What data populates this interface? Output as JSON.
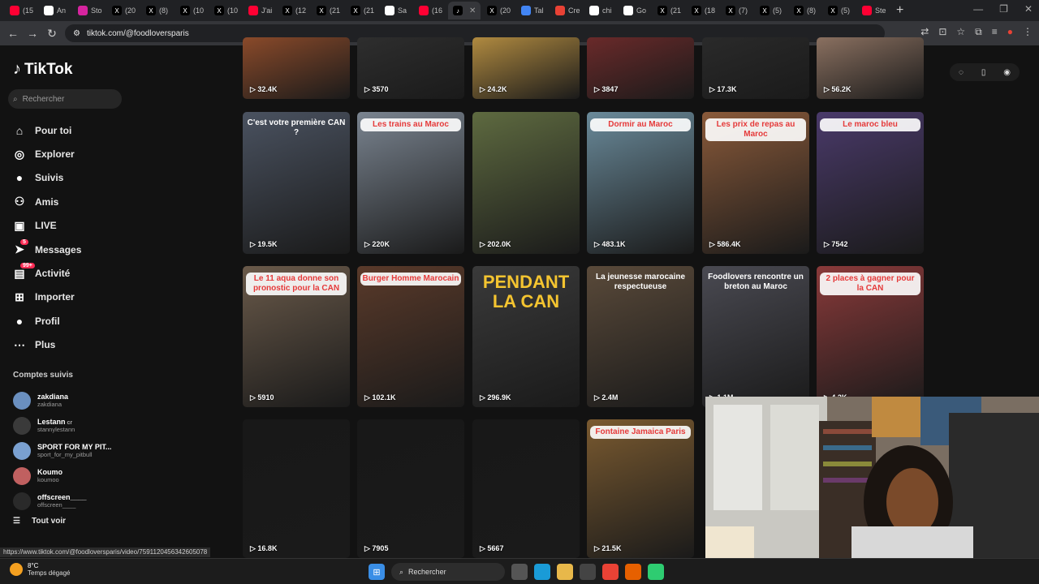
{
  "browser": {
    "tabs": [
      {
        "label": "(15",
        "icon": "youtube-icon",
        "color": "#ff0033"
      },
      {
        "label": "An",
        "icon": "wikipedia-icon",
        "color": "#ffffff"
      },
      {
        "label": "Sto",
        "icon": "instagram-icon",
        "color": "#d6249f"
      },
      {
        "label": "(20",
        "icon": "x-icon",
        "color": "#000000"
      },
      {
        "label": "(8)",
        "icon": "x-icon",
        "color": "#000000"
      },
      {
        "label": "(10",
        "icon": "x-icon",
        "color": "#000000"
      },
      {
        "label": "(10",
        "icon": "x-icon",
        "color": "#000000"
      },
      {
        "label": "J'ai",
        "icon": "youtube-icon",
        "color": "#ff0033"
      },
      {
        "label": "(12",
        "icon": "x-icon",
        "color": "#000000"
      },
      {
        "label": "(21",
        "icon": "x-icon",
        "color": "#000000"
      },
      {
        "label": "(21",
        "icon": "x-icon",
        "color": "#000000"
      },
      {
        "label": "Sa",
        "icon": "page-icon",
        "color": "#ffffff"
      },
      {
        "label": "(16",
        "icon": "youtube-icon",
        "color": "#ff0033"
      },
      {
        "label": "",
        "icon": "tiktok-icon",
        "color": "#000000",
        "active": true
      },
      {
        "label": "(20",
        "icon": "x-icon",
        "color": "#000000"
      },
      {
        "label": "Tal",
        "icon": "translate-icon",
        "color": "#4285f4"
      },
      {
        "label": "Cre",
        "icon": "page-icon",
        "color": "#e94235"
      },
      {
        "label": "chi",
        "icon": "google-icon",
        "color": "#ffffff"
      },
      {
        "label": "Go",
        "icon": "google-icon",
        "color": "#ffffff"
      },
      {
        "label": "(21",
        "icon": "x-icon",
        "color": "#000000"
      },
      {
        "label": "(18",
        "icon": "x-icon",
        "color": "#000000"
      },
      {
        "label": "(7)",
        "icon": "x-icon",
        "color": "#000000"
      },
      {
        "label": "(5)",
        "icon": "x-icon",
        "color": "#000000"
      },
      {
        "label": "(8)",
        "icon": "x-icon",
        "color": "#000000"
      },
      {
        "label": "(5)",
        "icon": "x-icon",
        "color": "#000000"
      },
      {
        "label": "Ste",
        "icon": "youtube-icon",
        "color": "#ff0033"
      }
    ],
    "url": "tiktok.com/@foodloversparis",
    "status_url": "https://www.tiktok.com/@foodloversparis/video/7591120456342605078"
  },
  "sidebar": {
    "logo": "TikTok",
    "search_placeholder": "Rechercher",
    "nav": [
      {
        "label": "Pour toi",
        "icon": "home-icon",
        "glyph": "⌂"
      },
      {
        "label": "Explorer",
        "icon": "compass-icon",
        "glyph": "◎"
      },
      {
        "label": "Suivis",
        "icon": "avatar-icon",
        "glyph": "●"
      },
      {
        "label": "Amis",
        "icon": "friends-icon",
        "glyph": "⚇"
      },
      {
        "label": "LIVE",
        "icon": "live-icon",
        "glyph": "▣"
      },
      {
        "label": "Messages",
        "icon": "messages-icon",
        "glyph": "➤",
        "badge": "5"
      },
      {
        "label": "Activité",
        "icon": "activity-icon",
        "glyph": "▤",
        "badge": "99+"
      },
      {
        "label": "Importer",
        "icon": "upload-icon",
        "glyph": "⊞"
      },
      {
        "label": "Profil",
        "icon": "profile-icon",
        "glyph": "●"
      },
      {
        "label": "Plus",
        "icon": "more-icon",
        "glyph": "⋯"
      }
    ],
    "following_title": "Comptes suivis",
    "following": [
      {
        "name": "zakdiana",
        "handle": "zakdiana",
        "color": "#6a8fbf"
      },
      {
        "name": "Lestann",
        "handle": "stannylestann",
        "color": "#3a3a3a",
        "suffix": "cr"
      },
      {
        "name": "SPORT FOR MY PIT...",
        "handle": "sport_for_my_pitbull",
        "color": "#7aa0d0"
      },
      {
        "name": "Koumo",
        "handle": "koumoo",
        "color": "#c06060"
      },
      {
        "name": "offscreen____",
        "handle": "offscreen____",
        "color": "#2a2a2a"
      }
    ],
    "see_all": "Tout voir"
  },
  "toolbar_right": [
    "gauge-icon",
    "phone-icon",
    "avatar-icon"
  ],
  "videos": [
    {
      "row": 0,
      "col": 0,
      "count": "32.4K",
      "bg": "#8a4a2a",
      "caption": "",
      "capcolor": "#fff"
    },
    {
      "row": 0,
      "col": 1,
      "count": "3570",
      "bg": "#2e2e2e",
      "caption": "",
      "capcolor": "#fff"
    },
    {
      "row": 0,
      "col": 2,
      "count": "24.2K",
      "bg": "#b08a40",
      "caption": "",
      "capcolor": "#fff"
    },
    {
      "row": 0,
      "col": 3,
      "count": "3847",
      "bg": "#6a2a2a",
      "caption": "",
      "capcolor": "#fff"
    },
    {
      "row": 0,
      "col": 4,
      "count": "17.3K",
      "bg": "#2a2a2a",
      "caption": "",
      "capcolor": "#fff"
    },
    {
      "row": 0,
      "col": 5,
      "count": "56.2K",
      "bg": "#8a7060",
      "caption": "",
      "capcolor": "#fff"
    },
    {
      "row": 1,
      "col": 0,
      "count": "19.5K",
      "bg": "#4a5260",
      "caption": "C'est votre première CAN ?",
      "capcolor": "#fff"
    },
    {
      "row": 1,
      "col": 1,
      "count": "220K",
      "bg": "#7a8490",
      "caption": "Les trains au Maroc",
      "capcolor": "#e53a3a"
    },
    {
      "row": 1,
      "col": 2,
      "count": "202.0K",
      "bg": "#5e6a40",
      "caption": "",
      "capcolor": "#fff"
    },
    {
      "row": 1,
      "col": 3,
      "count": "483.1K",
      "bg": "#6a8a9a",
      "caption": "Dormir au Maroc",
      "capcolor": "#e53a3a"
    },
    {
      "row": 1,
      "col": 4,
      "count": "586.4K",
      "bg": "#8a5a3a",
      "caption": "Les prix de repas au Maroc",
      "capcolor": "#e53a3a"
    },
    {
      "row": 1,
      "col": 5,
      "count": "7542",
      "bg": "#4a3a6a",
      "caption": "Le maroc bleu",
      "capcolor": "#e53a3a"
    },
    {
      "row": 2,
      "col": 0,
      "count": "5910",
      "bg": "#6a5a4a",
      "caption": "Le 11 aqua donne son pronostic pour la CAN",
      "capcolor": "#e53a3a"
    },
    {
      "row": 2,
      "col": 1,
      "count": "102.1K",
      "bg": "#5a3a2a",
      "caption": "Burger Homme Marocain",
      "capcolor": "#e53a3a"
    },
    {
      "row": 2,
      "col": 2,
      "count": "296.9K",
      "bg": "#3a3a3a",
      "caption": "PENDANT LA CAN",
      "capcolor": "#f4c430"
    },
    {
      "row": 2,
      "col": 3,
      "count": "2.4M",
      "bg": "#5a4a3a",
      "caption": "La jeunesse marocaine respectueuse",
      "capcolor": "#fff"
    },
    {
      "row": 2,
      "col": 4,
      "count": "1.1M",
      "bg": "#4a4a52",
      "caption": "Foodlovers rencontre un breton au Maroc",
      "capcolor": "#fff"
    },
    {
      "row": 2,
      "col": 5,
      "count": "4.2K",
      "bg": "#8a3a3a",
      "caption": "2 places à gagner pour la CAN",
      "capcolor": "#e53a3a"
    },
    {
      "row": 3,
      "col": 0,
      "count": "16.8K",
      "bg": "#181818",
      "caption": "",
      "capcolor": "#fff"
    },
    {
      "row": 3,
      "col": 1,
      "count": "7905",
      "bg": "#181818",
      "caption": "",
      "capcolor": "#fff"
    },
    {
      "row": 3,
      "col": 2,
      "count": "5667",
      "bg": "#181818",
      "caption": "",
      "capcolor": "#fff"
    },
    {
      "row": 3,
      "col": 3,
      "count": "21.5K",
      "bg": "#7a5a30",
      "caption": "Fontaine Jamaica Paris",
      "capcolor": "#e53a3a"
    }
  ],
  "taskbar": {
    "temp": "8°C",
    "weather": "Temps dégagé",
    "search": "Rechercher",
    "apps": [
      {
        "icon": "windows-icon",
        "color": "#3a8ee6"
      },
      {
        "icon": "search-icon",
        "color": "#2d2d2d"
      },
      {
        "icon": "task-view-icon",
        "color": "#555"
      },
      {
        "icon": "edge-icon",
        "color": "#1a9bd7"
      },
      {
        "icon": "folder-icon",
        "color": "#e8b84a"
      },
      {
        "icon": "store-icon",
        "color": "#444"
      },
      {
        "icon": "chrome-icon",
        "color": "#e94235"
      },
      {
        "icon": "firefox-icon",
        "color": "#e66000"
      },
      {
        "icon": "app-icon",
        "color": "#2ecc71"
      }
    ]
  }
}
